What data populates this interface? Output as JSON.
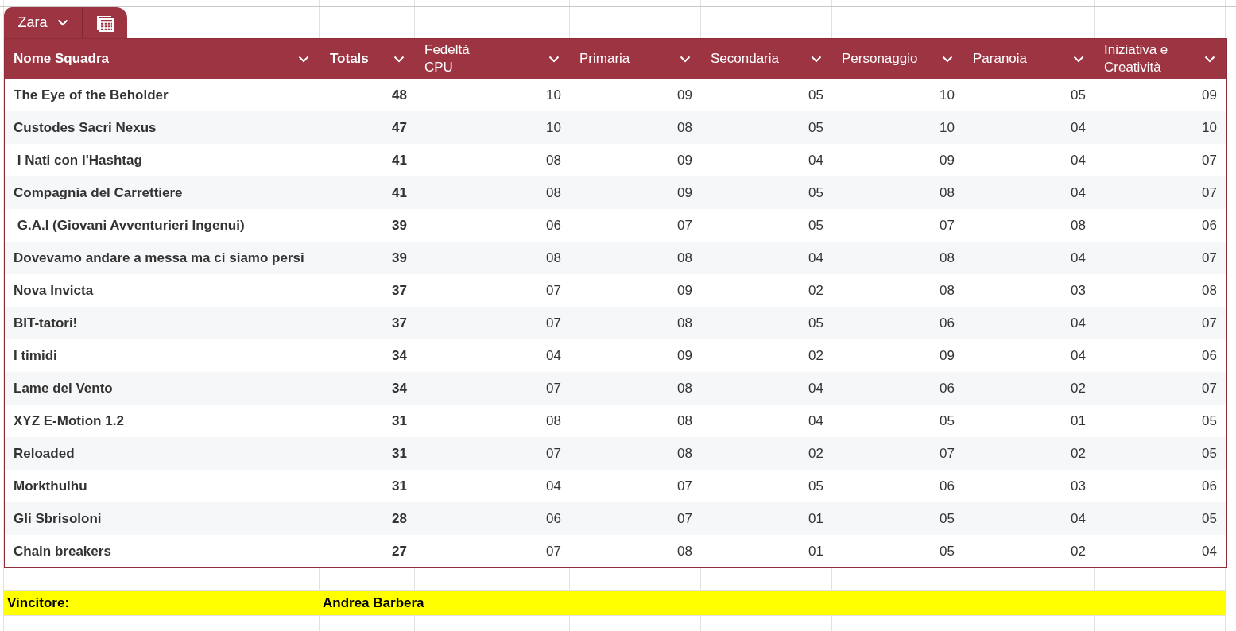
{
  "tab": {
    "label": "Zara"
  },
  "table": {
    "columns": [
      {
        "label": "Nome Squadra"
      },
      {
        "label": "Totals"
      },
      {
        "label": "Fedeltà CPU"
      },
      {
        "label": "Primaria"
      },
      {
        "label": "Secondaria"
      },
      {
        "label": "Personaggio"
      },
      {
        "label": "Paranoia"
      },
      {
        "label": "Iniziativa e Creatività"
      }
    ],
    "rows": [
      {
        "cells": [
          "The Eye of the Beholder",
          "48",
          "10",
          "09",
          "05",
          "10",
          "05",
          "09"
        ]
      },
      {
        "cells": [
          "Custodes Sacri Nexus",
          "47",
          "10",
          "08",
          "05",
          "10",
          "04",
          "10"
        ]
      },
      {
        "cells": [
          " I Nati con l'Hashtag",
          "41",
          "08",
          "09",
          "04",
          "09",
          "04",
          "07"
        ]
      },
      {
        "cells": [
          "Compagnia del Carrettiere",
          "41",
          "08",
          "09",
          "05",
          "08",
          "04",
          "07"
        ]
      },
      {
        "cells": [
          " G.A.I (Giovani Avventurieri Ingenui)",
          "39",
          "06",
          "07",
          "05",
          "07",
          "08",
          "06"
        ]
      },
      {
        "cells": [
          "Dovevamo andare a messa ma ci siamo persi",
          "39",
          "08",
          "08",
          "04",
          "08",
          "04",
          "07"
        ]
      },
      {
        "cells": [
          "Nova Invicta",
          "37",
          "07",
          "09",
          "02",
          "08",
          "03",
          "08"
        ]
      },
      {
        "cells": [
          "BIT-tatori!",
          "37",
          "07",
          "08",
          "05",
          "06",
          "04",
          "07"
        ]
      },
      {
        "cells": [
          "I timidi",
          "34",
          "04",
          "09",
          "02",
          "09",
          "04",
          "06"
        ]
      },
      {
        "cells": [
          "Lame del Vento",
          "34",
          "07",
          "08",
          "04",
          "06",
          "02",
          "07"
        ]
      },
      {
        "cells": [
          "XYZ E-Motion 1.2",
          "31",
          "08",
          "08",
          "04",
          "05",
          "01",
          "05"
        ]
      },
      {
        "cells": [
          "Reloaded",
          "31",
          "07",
          "08",
          "02",
          "07",
          "02",
          "05"
        ]
      },
      {
        "cells": [
          "Morkthulhu",
          "31",
          "04",
          "07",
          "05",
          "06",
          "03",
          "06"
        ]
      },
      {
        "cells": [
          "Gli Sbrisoloni",
          "28",
          "06",
          "07",
          "01",
          "05",
          "04",
          "05"
        ]
      },
      {
        "cells": [
          "Chain breakers",
          "27",
          "07",
          "08",
          "01",
          "05",
          "02",
          "04"
        ]
      }
    ]
  },
  "winner": {
    "label": "Vincitore:",
    "value": "Andrea Barbera"
  }
}
